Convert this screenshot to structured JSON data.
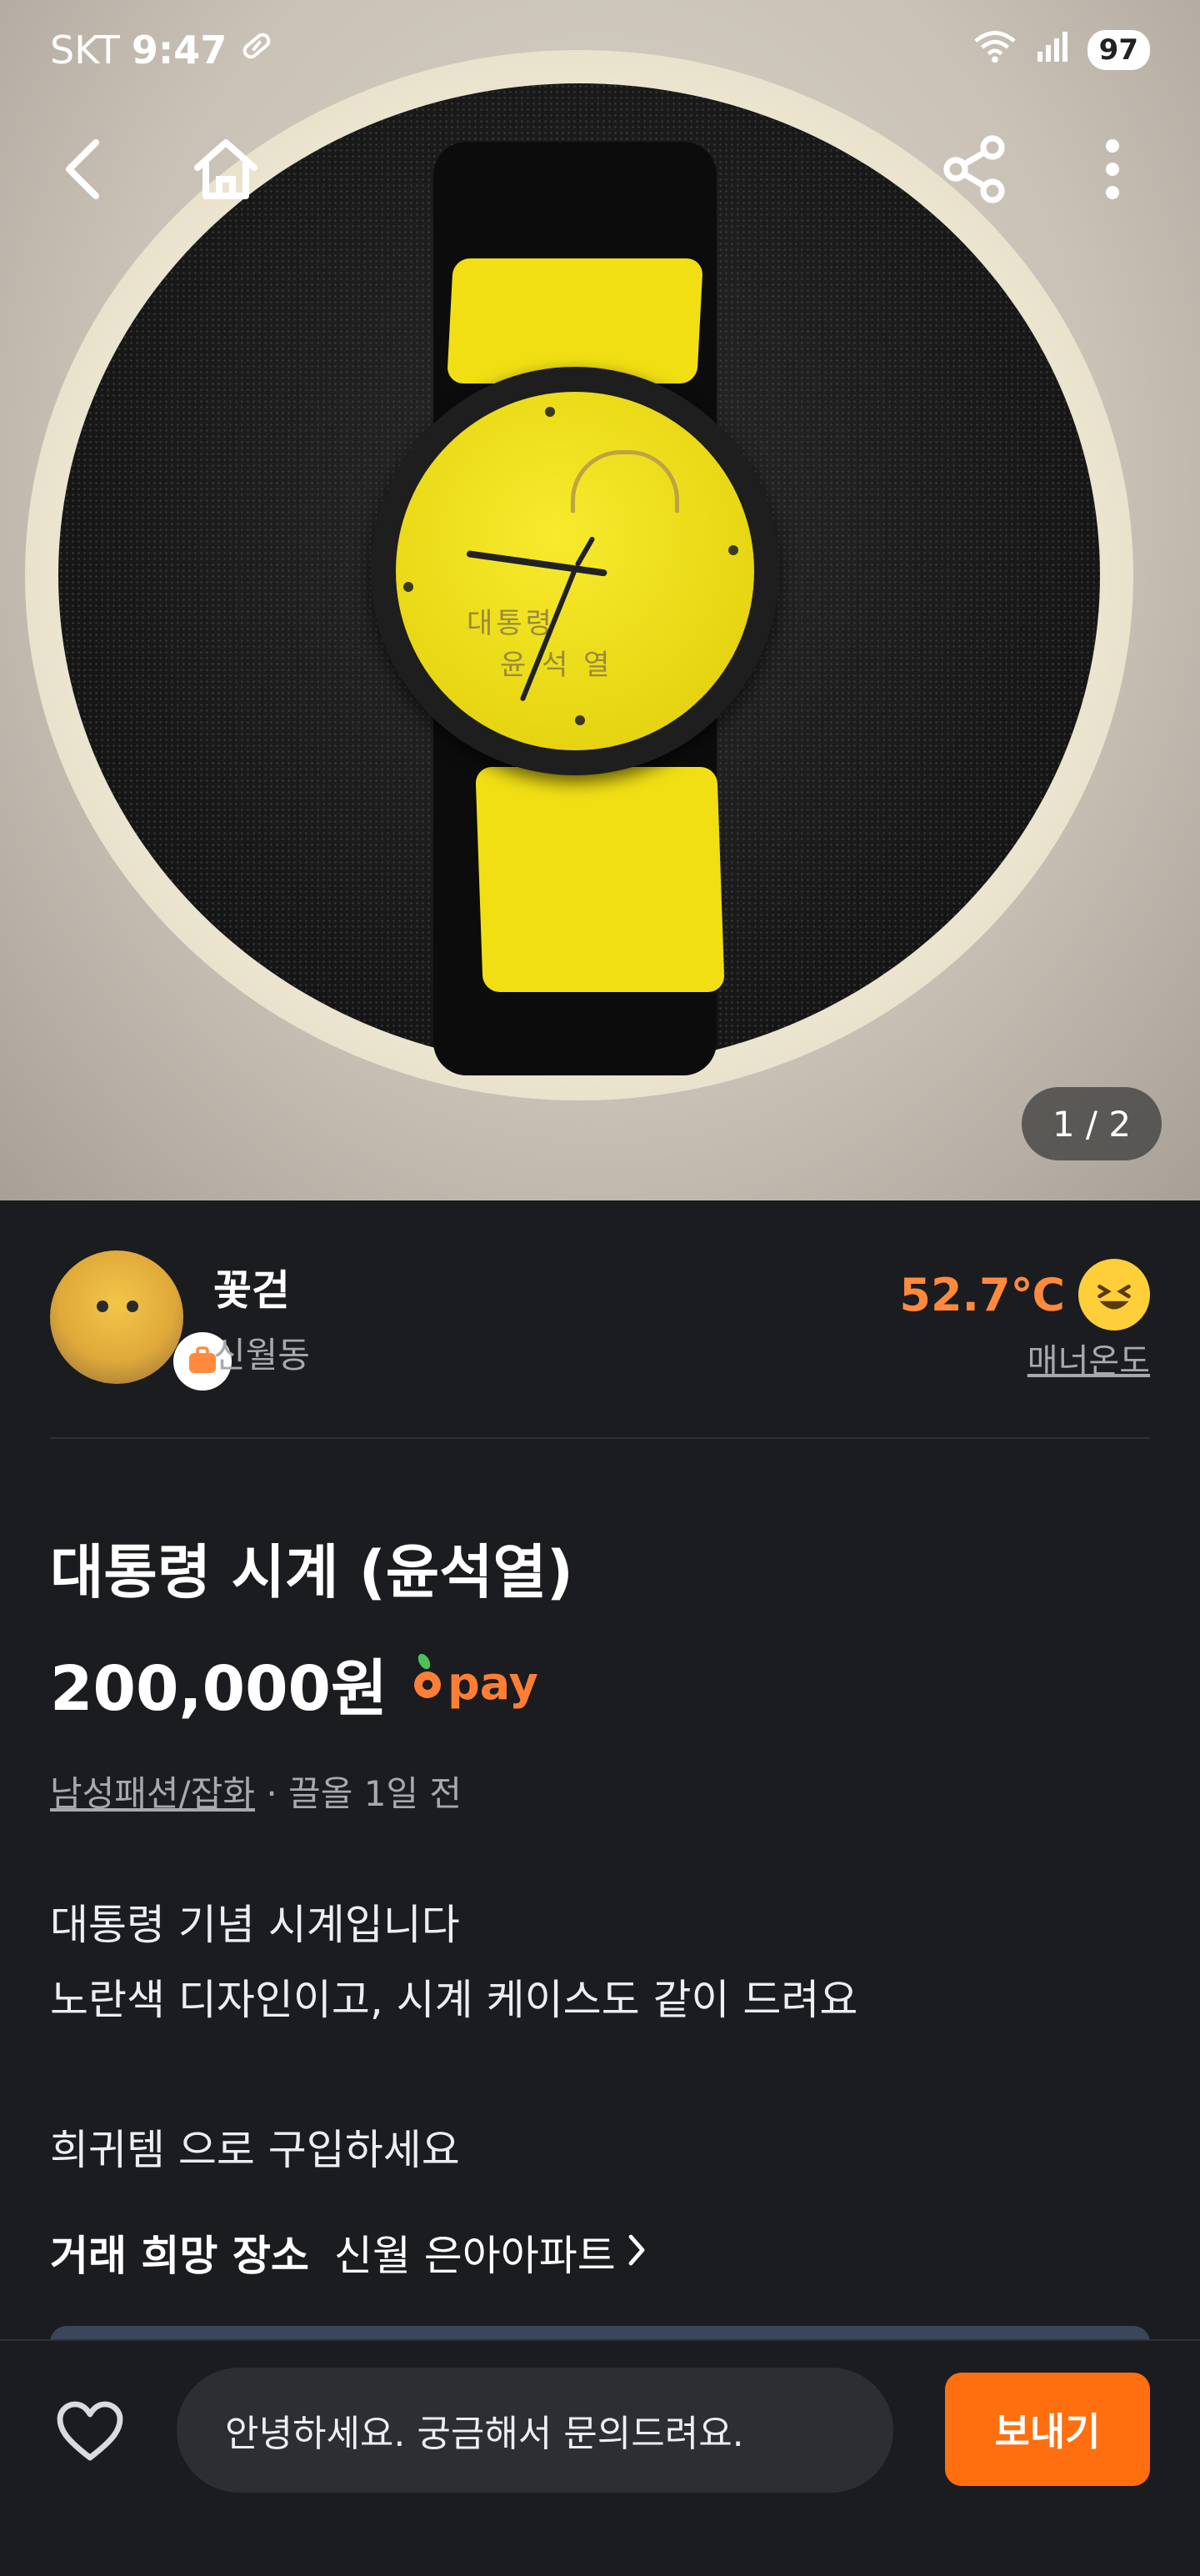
{
  "status_bar": {
    "carrier": "SKT",
    "time": "9:47",
    "battery": "97"
  },
  "image_counter": "1 / 2",
  "seller": {
    "name": "꽃걷",
    "location": "신월동",
    "temperature": "52.7℃",
    "temperature_label": "매너온도"
  },
  "listing": {
    "title": "대통령 시계 (윤석열)",
    "price": "200,000원",
    "pay_label": "pay",
    "category": "남성패션/잡화",
    "time_info": "· 끌올 1일 전",
    "description_lines": [
      "대통령 기념 시계입니다",
      "노란색 디자인이고, 시계 케이스도 같이 드려요",
      "",
      "희귀템 으로 구입하세요"
    ],
    "place_label": "거래 희망 장소",
    "place_value": "신월 은아아파트"
  },
  "bottom_bar": {
    "chat_text": "안녕하세요. 궁금해서 문의드려요.",
    "send_label": "보내기"
  },
  "colors": {
    "accent": "#ff6f0f",
    "temperature": "#ff8a3d",
    "background": "#1b1c1f",
    "muted_text": "#a7a9ae"
  },
  "icons": [
    "back-icon",
    "home-icon",
    "share-icon",
    "more-icon",
    "heart-icon",
    "chevron-right-icon",
    "wifi-icon",
    "signal-icon",
    "pill-icon",
    "carrot-icon",
    "laughing-emoji-icon"
  ]
}
